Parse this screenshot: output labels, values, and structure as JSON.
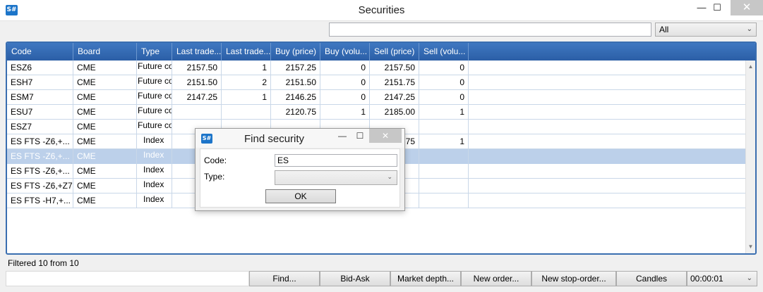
{
  "app_icon": "S#",
  "window": {
    "title": "Securities",
    "minimize": "—",
    "maximize": "☐",
    "close": "✕"
  },
  "filter": {
    "search_value": "",
    "category_value": "All"
  },
  "table": {
    "columns": [
      "Code",
      "Board",
      "Type",
      "Last trade...",
      "Last trade...",
      "Buy (price)",
      "Buy (volu...",
      "Sell (price)",
      "Sell (volu..."
    ],
    "rows": [
      {
        "code": "ESZ6",
        "board": "CME",
        "type": "Future co",
        "last_price": "2157.50",
        "last_vol": "1",
        "buy_price": "2157.25",
        "buy_vol": "0",
        "sell_price": "2157.50",
        "sell_vol": "0"
      },
      {
        "code": "ESH7",
        "board": "CME",
        "type": "Future co",
        "last_price": "2151.50",
        "last_vol": "2",
        "buy_price": "2151.50",
        "buy_vol": "0",
        "sell_price": "2151.75",
        "sell_vol": "0"
      },
      {
        "code": "ESM7",
        "board": "CME",
        "type": "Future co",
        "last_price": "2147.25",
        "last_vol": "1",
        "buy_price": "2146.25",
        "buy_vol": "0",
        "sell_price": "2147.25",
        "sell_vol": "0"
      },
      {
        "code": "ESU7",
        "board": "CME",
        "type": "Future co",
        "last_price": "",
        "last_vol": "",
        "buy_price": "2120.75",
        "buy_vol": "1",
        "sell_price": "2185.00",
        "sell_vol": "1"
      },
      {
        "code": "ESZ7",
        "board": "CME",
        "type": "Future co",
        "last_price": "",
        "last_vol": "",
        "buy_price": "",
        "buy_vol": "",
        "sell_price": "",
        "sell_vol": ""
      },
      {
        "code": "ES FTS -Z6,+...",
        "board": "CME",
        "type": "Index",
        "last_price": "",
        "last_vol": "",
        "buy_price": "",
        "buy_vol": "",
        "sell_price": "75",
        "sell_vol": "1"
      },
      {
        "code": "ES FTS -Z6,+...",
        "board": "CME",
        "type": "Index",
        "last_price": "",
        "last_vol": "",
        "buy_price": "",
        "buy_vol": "",
        "sell_price": "",
        "sell_vol": ""
      },
      {
        "code": "ES FTS -Z6,+...",
        "board": "CME",
        "type": "Index",
        "last_price": "",
        "last_vol": "",
        "buy_price": "",
        "buy_vol": "",
        "sell_price": "",
        "sell_vol": ""
      },
      {
        "code": "ES FTS -Z6,+Z7",
        "board": "CME",
        "type": "Index",
        "last_price": "",
        "last_vol": "",
        "buy_price": "",
        "buy_vol": "",
        "sell_price": "",
        "sell_vol": ""
      },
      {
        "code": "ES FTS -H7,+...",
        "board": "CME",
        "type": "Index",
        "last_price": "",
        "last_vol": "",
        "buy_price": "",
        "buy_vol": "",
        "sell_price": "",
        "sell_vol": ""
      }
    ],
    "selected_row": 6
  },
  "status": "Filtered 10 from 10",
  "toolbar": {
    "find": "Find...",
    "bid_ask": "Bid-Ask",
    "market_depth": "Market depth...",
    "new_order": "New order...",
    "new_stop_order": "New stop-order...",
    "candles": "Candles",
    "interval": "00:00:01"
  },
  "dialog": {
    "title": "Find security",
    "code_label": "Code:",
    "code_value": "ES",
    "type_label": "Type:",
    "type_value": "",
    "ok": "OK",
    "minimize": "—",
    "maximize": "☐",
    "close": "✕"
  },
  "colors": {
    "header_blue": "#2b5ea6",
    "selected_row": "#bcd0ea",
    "close_gray": "#c7c7c7"
  }
}
